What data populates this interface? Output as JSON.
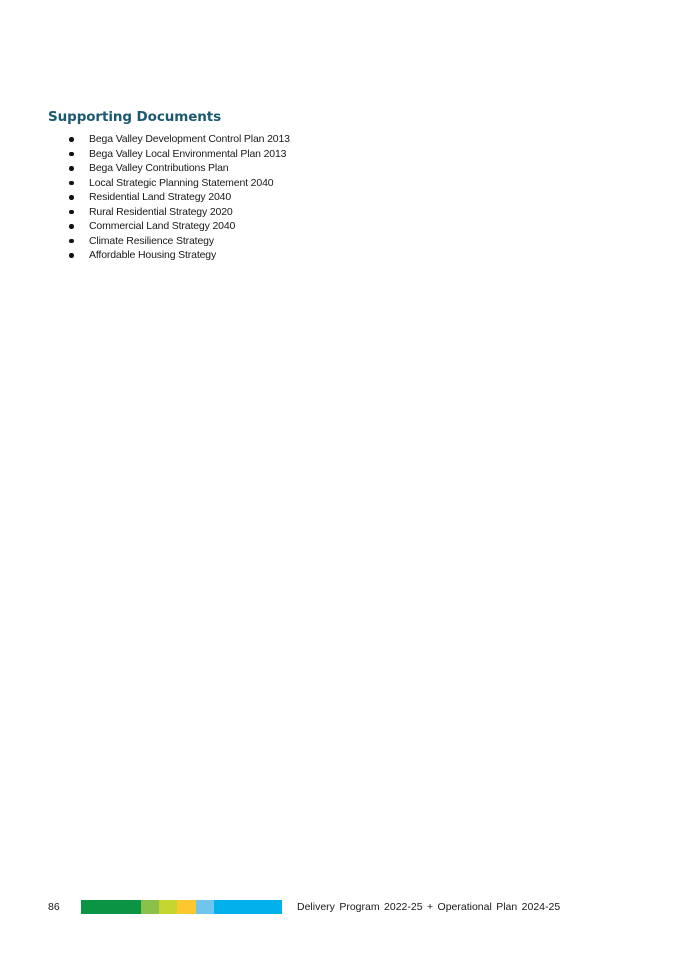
{
  "section": {
    "heading": "Supporting Documents",
    "documents": [
      "Bega Valley Development Control Plan 2013",
      "Bega Valley Local Environmental Plan 2013",
      "Bega Valley Contributions Plan",
      "Local Strategic Planning Statement 2040",
      "Residential Land Strategy 2040",
      "Rural Residential Strategy 2020",
      "Commercial Land Strategy 2040",
      "Climate Resilience Strategy",
      "Affordable Housing Strategy"
    ]
  },
  "footer": {
    "page_number": "86",
    "title": "Delivery Program 2022-25 + Operational Plan 2024-25",
    "color_bar": [
      {
        "name": "dark-green",
        "color": "#0a9444"
      },
      {
        "name": "light-green",
        "color": "#8bc04a"
      },
      {
        "name": "lime",
        "color": "#c5d631"
      },
      {
        "name": "yellow",
        "color": "#fdc82f"
      },
      {
        "name": "light-blue",
        "color": "#6ec6ef"
      },
      {
        "name": "blue",
        "color": "#00b1eb"
      }
    ]
  },
  "colors": {
    "heading": "#1c5a70",
    "text": "#1a1a1a"
  }
}
